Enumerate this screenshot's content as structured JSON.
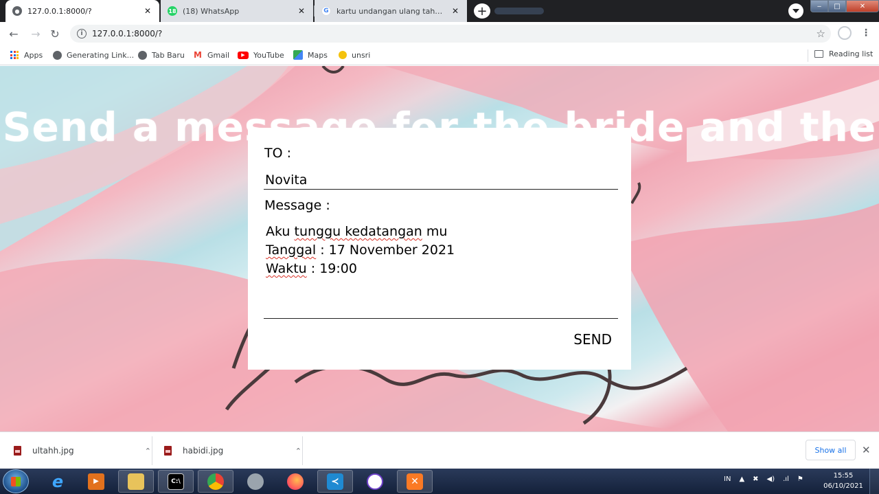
{
  "browser": {
    "tabs": [
      {
        "title": "127.0.0.1:8000/?",
        "active": true,
        "favicon": "globe-icon"
      },
      {
        "title": "(18) WhatsApp",
        "active": false,
        "favicon": "whatsapp-icon",
        "badge": "18"
      },
      {
        "title": "kartu undangan ulang tahun - Go",
        "active": false,
        "favicon": "google-icon"
      }
    ],
    "close_glyph": "✕",
    "new_tab_glyph": "+",
    "url": "127.0.0.1:8000/?",
    "bookmarks": [
      {
        "label": "Apps",
        "icon": "apps-grid-icon"
      },
      {
        "label": "Generating Link...",
        "icon": "globe-icon"
      },
      {
        "label": "Tab Baru",
        "icon": "globe-icon"
      },
      {
        "label": "Gmail",
        "icon": "gmail-icon"
      },
      {
        "label": "YouTube",
        "icon": "youtube-icon"
      },
      {
        "label": "Maps",
        "icon": "maps-icon"
      },
      {
        "label": "unsri",
        "icon": "unsri-icon"
      }
    ],
    "reading_list": "Reading list"
  },
  "page": {
    "headline": "Send a message for the bride and the",
    "form": {
      "to_label": "TO :",
      "to_value": "Novita",
      "message_label": "Message :",
      "message_lines": [
        {
          "pre": "Aku ",
          "wavy": "tunggu kedatangan",
          "post": " mu"
        },
        {
          "pre": "",
          "wavy": "Tanggal",
          "post": " : 17 November 2021"
        },
        {
          "pre": "",
          "wavy": "Waktu",
          "post": " : 19:00"
        }
      ],
      "send_label": "SEND"
    },
    "colors": {
      "pink": "#f1a9b6",
      "blue": "#b9dfe6",
      "white_band": "#f3f1f2",
      "script_ink": "#4a3a3c"
    }
  },
  "downloads": {
    "items": [
      {
        "name": "ultahh.jpg"
      },
      {
        "name": "habidi.jpg"
      }
    ],
    "show_all": "Show all"
  },
  "taskbar": {
    "language": "IN",
    "time": "15:55",
    "date": "06/10/2021",
    "apps": [
      "internet-explorer-icon",
      "media-player-icon",
      "file-explorer-icon",
      "command-prompt-icon",
      "chrome-icon",
      "speaker-icon",
      "firefox-icon",
      "vscode-icon",
      "github-icon",
      "xampp-icon"
    ]
  }
}
